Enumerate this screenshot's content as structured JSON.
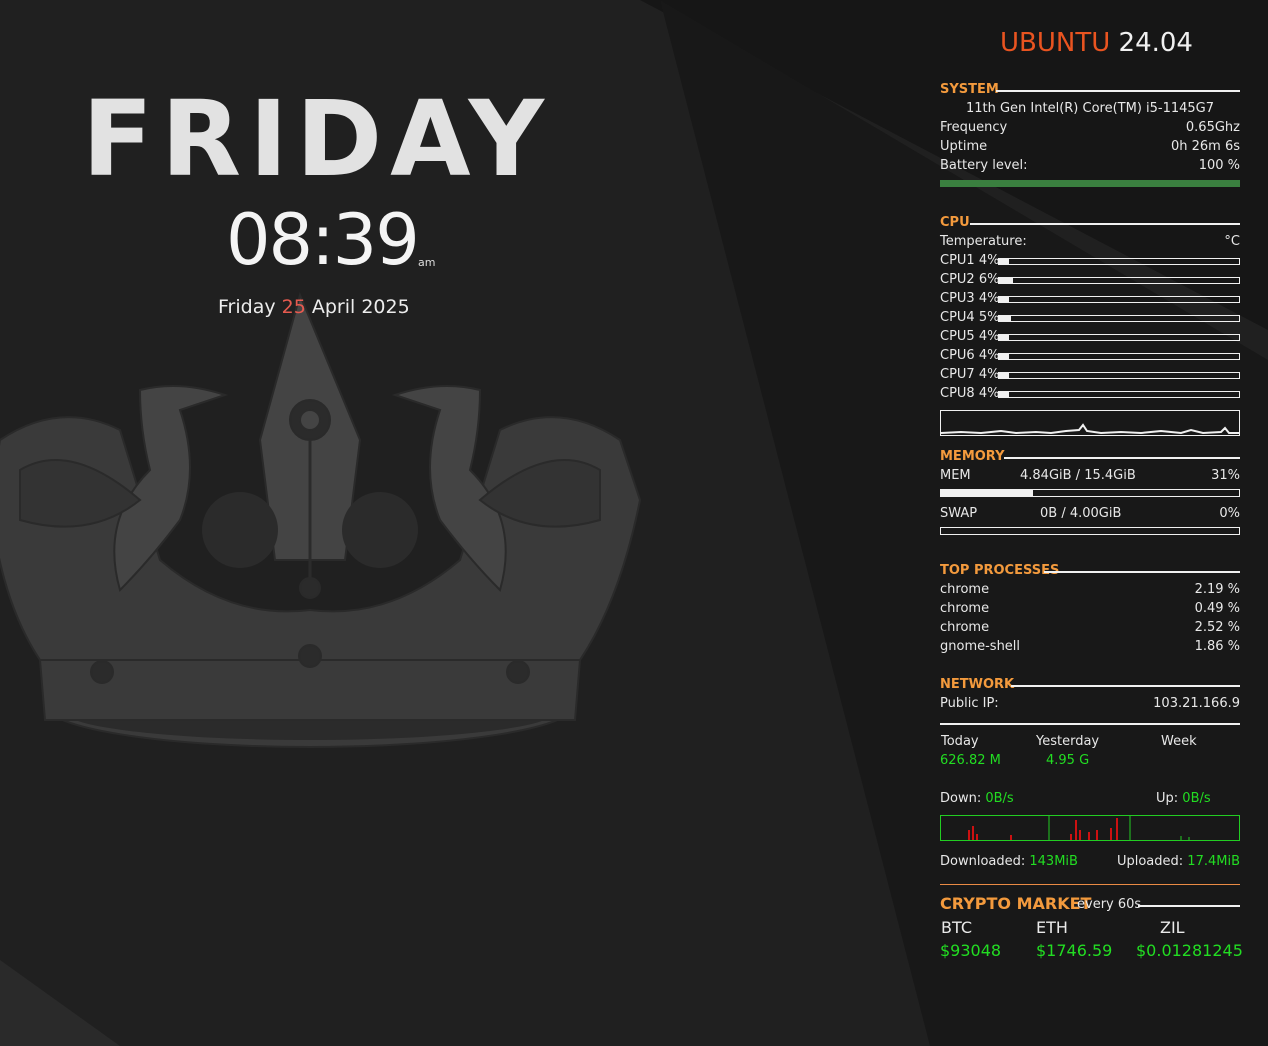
{
  "clock": {
    "day_name": "FRIDAY",
    "time": "08:39",
    "ampm": "am",
    "date_weekday": "Friday",
    "date_day": "25",
    "date_rest": "April 2025"
  },
  "os": {
    "brand": "UBUNTU",
    "version": "24.04"
  },
  "system": {
    "heading": "SYSTEM",
    "cpu_model": "11th Gen Intel(R) Core(TM) i5-1145G7",
    "frequency_label": "Frequency",
    "frequency_value": "0.65Ghz",
    "uptime_label": "Uptime",
    "uptime_value": "0h 26m 6s",
    "battery_label": "Battery level:",
    "battery_value": "100 %",
    "battery_fraction": 1.0,
    "battery_color": "#3a7f3f"
  },
  "cpu": {
    "heading": "CPU",
    "temperature_label": "Temperature:",
    "temperature_value": "°C",
    "cores": [
      {
        "label": "CPU1 4%",
        "percent": 4
      },
      {
        "label": "CPU2 6%",
        "percent": 6
      },
      {
        "label": "CPU3 4%",
        "percent": 4
      },
      {
        "label": "CPU4 5%",
        "percent": 5
      },
      {
        "label": "CPU5 4%",
        "percent": 4
      },
      {
        "label": "CPU6 4%",
        "percent": 4
      },
      {
        "label": "CPU7 4%",
        "percent": 4
      },
      {
        "label": "CPU8 4%",
        "percent": 4
      }
    ]
  },
  "memory": {
    "heading": "MEMORY",
    "mem_label": "MEM",
    "mem_usage": "4.84GiB / 15.4GiB",
    "mem_percent_text": "31%",
    "mem_percent": 31,
    "swap_label": "SWAP",
    "swap_usage": "0B / 4.00GiB",
    "swap_percent_text": "0%",
    "swap_percent": 0
  },
  "processes": {
    "heading": "TOP PROCESSES",
    "items": [
      {
        "name": "chrome",
        "cpu": "2.19 %"
      },
      {
        "name": "chrome",
        "cpu": "0.49 %"
      },
      {
        "name": "chrome",
        "cpu": "2.52 %"
      },
      {
        "name": "gnome-shell",
        "cpu": "1.86 %"
      }
    ]
  },
  "network": {
    "heading": "NETWORK",
    "public_ip_label": "Public IP:",
    "public_ip": "103.21.166.9",
    "today_label": "Today",
    "today_value": "626.82 M",
    "yesterday_label": "Yesterday",
    "yesterday_value": "4.95 G",
    "week_label": "Week",
    "down_label": "Down:",
    "down_value": "0B/s",
    "up_label": "Up:",
    "up_value": "0B/s",
    "downloaded_label": "Downloaded:",
    "downloaded_value": "143MiB",
    "uploaded_label": "Uploaded:",
    "uploaded_value": "17.4MiB"
  },
  "crypto": {
    "heading": "CRYPTO MARKET",
    "subheading": "every 60s",
    "coins": [
      {
        "name": "BTC",
        "price": "$93048"
      },
      {
        "name": "ETH",
        "price": "$1746.59"
      },
      {
        "name": "ZIL",
        "price": "$0.01281245"
      }
    ]
  },
  "colors": {
    "accent_orange": "#f39a3d",
    "ubuntu_orange": "#e95420",
    "value_green": "#22dd22",
    "date_red": "#e65a4f",
    "background": "#1f1f1f"
  }
}
